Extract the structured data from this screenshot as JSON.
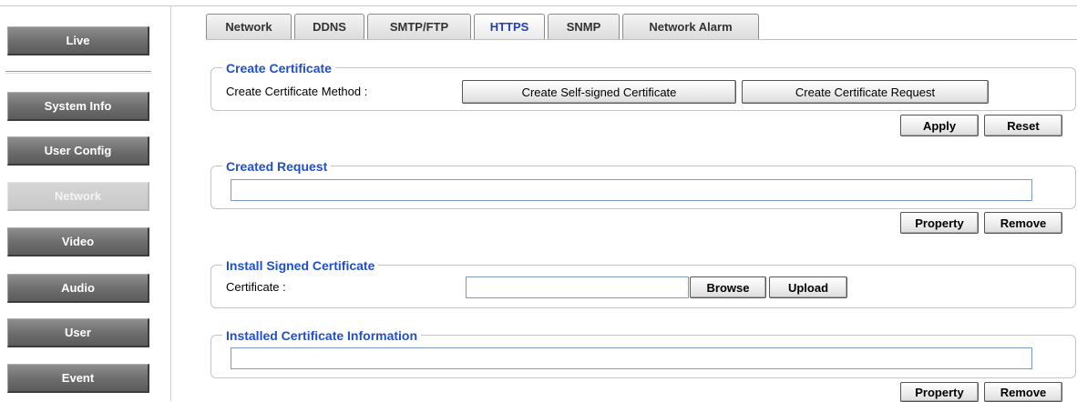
{
  "sidebar": {
    "items": [
      {
        "label": "Live"
      },
      {
        "label": "System Info"
      },
      {
        "label": "User Config"
      },
      {
        "label": "Network"
      },
      {
        "label": "Video"
      },
      {
        "label": "Audio"
      },
      {
        "label": "User"
      },
      {
        "label": "Event"
      }
    ],
    "active": "Network"
  },
  "tabs": [
    {
      "label": "Network"
    },
    {
      "label": "DDNS"
    },
    {
      "label": "SMTP/FTP"
    },
    {
      "label": "HTTPS"
    },
    {
      "label": "SNMP"
    },
    {
      "label": "Network Alarm"
    }
  ],
  "active_tab": "HTTPS",
  "create_certificate": {
    "legend": "Create Certificate",
    "method_label": "Create Certificate Method :",
    "self_signed_button": "Create Self-signed Certificate",
    "request_button": "Create Certificate Request",
    "apply_button": "Apply",
    "reset_button": "Reset"
  },
  "created_request": {
    "legend": "Created Request",
    "value": "",
    "property_button": "Property",
    "remove_button": "Remove"
  },
  "install_signed": {
    "legend": "Install Signed Certificate",
    "certificate_label": "Certificate :",
    "value": "",
    "browse_button": "Browse",
    "upload_button": "Upload"
  },
  "installed_info": {
    "legend": "Installed Certificate Information",
    "value": "",
    "property_button": "Property",
    "remove_button": "Remove"
  },
  "colors": {
    "legend_blue": "#1f4fd0",
    "active_tab_blue": "#1f3fbf",
    "sidebar_button": "#6f6f6f",
    "sidebar_active": "#c8c8c8"
  }
}
